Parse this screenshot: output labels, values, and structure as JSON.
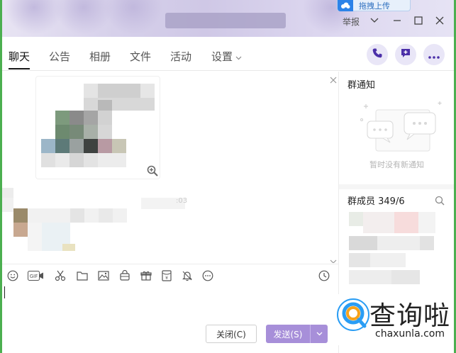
{
  "cloud_badge": {
    "label": "拖拽上传"
  },
  "window_controls": {
    "report_label": "举报"
  },
  "tabs": [
    {
      "label": "聊天",
      "active": true
    },
    {
      "label": "公告",
      "active": false
    },
    {
      "label": "相册",
      "active": false
    },
    {
      "label": "文件",
      "active": false
    },
    {
      "label": "活动",
      "active": false
    },
    {
      "label": "设置",
      "active": false
    }
  ],
  "header_actions": [
    "phone-icon",
    "group-message-icon",
    "more-icon"
  ],
  "chat": {
    "timestamp": ":03"
  },
  "toolbar_icons": [
    "emoji-icon",
    "gif-icon",
    "scissors-icon",
    "folder-icon",
    "image-icon",
    "bag-icon",
    "gift-icon",
    "red-packet-icon",
    "bell-icon",
    "more-circle-icon",
    "clock-icon"
  ],
  "toolbar": {
    "gif_label": "GIF"
  },
  "compose": {
    "close_label": "关闭(C)",
    "send_label": "发送(S)"
  },
  "right_panel": {
    "notice_title": "群通知",
    "notice_empty": "暂时没有新通知",
    "members_title": "群成员 349/6"
  },
  "watermark": {
    "title": "查询啦",
    "url": "chaxunla.com"
  },
  "colors": {
    "accent": "#a78fd9",
    "button_bg": "#e9e6f7",
    "background": "#4caf50"
  }
}
